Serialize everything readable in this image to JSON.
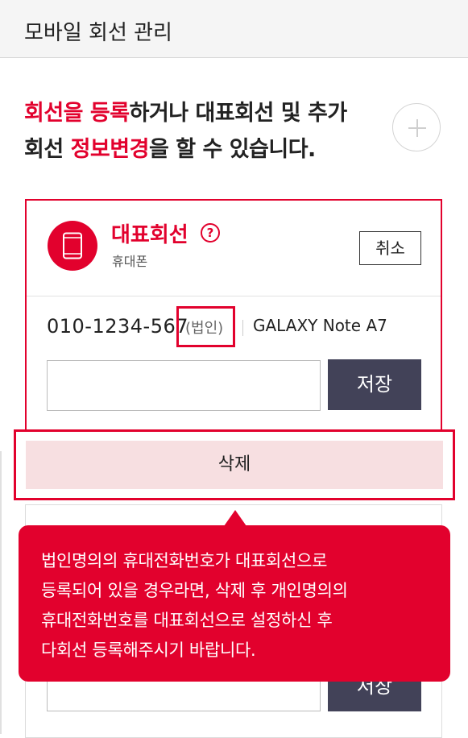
{
  "header": {
    "title": "모바일 회선 관리"
  },
  "intro": {
    "part1_red": "회선을 등록",
    "part2": "하거나 대표회선 및 추가",
    "part3": "회선 ",
    "part4_red": "정보변경",
    "part5": "을 할 수 있습니다."
  },
  "add_button": {
    "icon": "plus-icon"
  },
  "main_line": {
    "title": "대표회선",
    "help_icon_glyph": "?",
    "subtitle": "휴대폰",
    "cancel_label": "취소",
    "phone_number": "010-1234-567",
    "corp_tag": "(법인)",
    "model": "GALAXY Note A7",
    "input_value": "",
    "save_label": "저장",
    "icon": "smartphone-icon"
  },
  "delete_label": "삭제",
  "second_line": {
    "save_label": "저장"
  },
  "tooltip": {
    "lines": [
      "법인명의의 휴대전화번호가 대표회선으로",
      "등록되어 있을 경우라면, 삭제 후 개인명의의",
      "휴대전화번호를 대표회선으로 설정하신 후",
      "다회선 등록해주시기 바랍니다."
    ]
  },
  "colors": {
    "accent": "#e2012d",
    "button_dark": "#424258",
    "delete_bg": "#f7dfe1"
  }
}
